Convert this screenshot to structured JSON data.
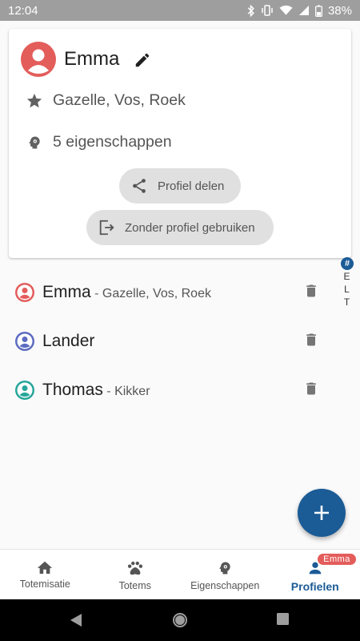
{
  "status_bar": {
    "time": "12:04",
    "battery": "38%",
    "icons": [
      "bluetooth-icon",
      "vibrate-icon",
      "wifi-icon",
      "signal-icon",
      "battery-icon"
    ]
  },
  "profile_card": {
    "name": "Emma",
    "totems": "Gazelle, Vos, Roek",
    "traits": "5 eigenschappen",
    "share_label": "Profiel delen",
    "no_profile_label": "Zonder profiel gebruiken",
    "avatar_color": "#e35d5b"
  },
  "alpha_index": {
    "hash": "#",
    "letters": [
      "E",
      "L",
      "T"
    ]
  },
  "profiles": [
    {
      "name": "Emma",
      "separator": " - ",
      "totems": "Gazelle, Vos, Roek",
      "color": "#e35d5b"
    },
    {
      "name": "Lander",
      "separator": "",
      "totems": "",
      "color": "#5c6bc0"
    },
    {
      "name": "Thomas",
      "separator": " - ",
      "totems": "Kikker",
      "color": "#26a69a"
    }
  ],
  "fab": {
    "icon": "plus-icon"
  },
  "bottom_nav": {
    "items": [
      {
        "label": "Totemisatie",
        "icon": "home-icon"
      },
      {
        "label": "Totems",
        "icon": "paw-icon"
      },
      {
        "label": "Eigenschappen",
        "icon": "head-gear-icon"
      },
      {
        "label": "Profielen",
        "icon": "person-icon",
        "active": true
      }
    ],
    "badge": "Emma"
  },
  "colors": {
    "primary": "#1b5b96",
    "accent": "#e35d5b"
  }
}
